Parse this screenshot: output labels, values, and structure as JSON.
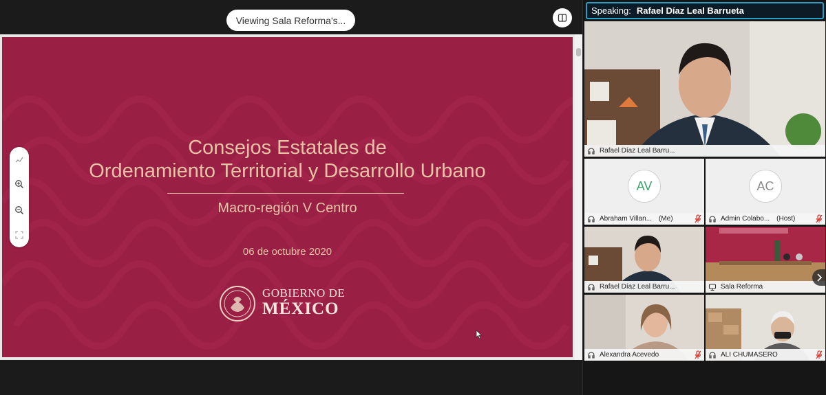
{
  "share": {
    "viewing_label": "Viewing Sala Reforma's...",
    "slide": {
      "title_line1": "Consejos Estatales de",
      "title_line2": "Ordenamiento Territorial y Desarrollo Urbano",
      "subtitle": "Macro-región V Centro",
      "date": "06 de octubre 2020",
      "logo_line1": "GOBIERNO DE",
      "logo_line2": "MÉXICO"
    },
    "tools": [
      "annotate-icon",
      "zoom-in-icon",
      "zoom-out-icon",
      "fit-screen-icon"
    ]
  },
  "panel": {
    "speaking_label": "Speaking:",
    "speaking_name": "Rafael Díaz Leal Barrueta",
    "participants": [
      {
        "name": "Rafael Díaz Leal Barru...",
        "host_tag": "",
        "avatar": "",
        "muted": false
      },
      {
        "name": "Abraham Villan...",
        "host_tag": "(Me)",
        "avatar": "AV",
        "muted": true
      },
      {
        "name": "Admin Colabo...",
        "host_tag": "(Host)",
        "avatar": "AC",
        "muted": true
      },
      {
        "name": "Rafael Díaz Leal Barru...",
        "host_tag": "",
        "avatar": "",
        "muted": false
      },
      {
        "name": "Sala Reforma",
        "host_tag": "",
        "avatar": "",
        "muted": false
      },
      {
        "name": "Alexandra Acevedo",
        "host_tag": "",
        "avatar": "",
        "muted": true
      },
      {
        "name": "ALI CHUMASERO",
        "host_tag": "",
        "avatar": "",
        "muted": true
      }
    ]
  },
  "colors": {
    "slide_bg": "#9a1f45",
    "slide_text": "#e6c3a6",
    "accent": "#2aa0c8",
    "mute_red": "#d9362b"
  }
}
